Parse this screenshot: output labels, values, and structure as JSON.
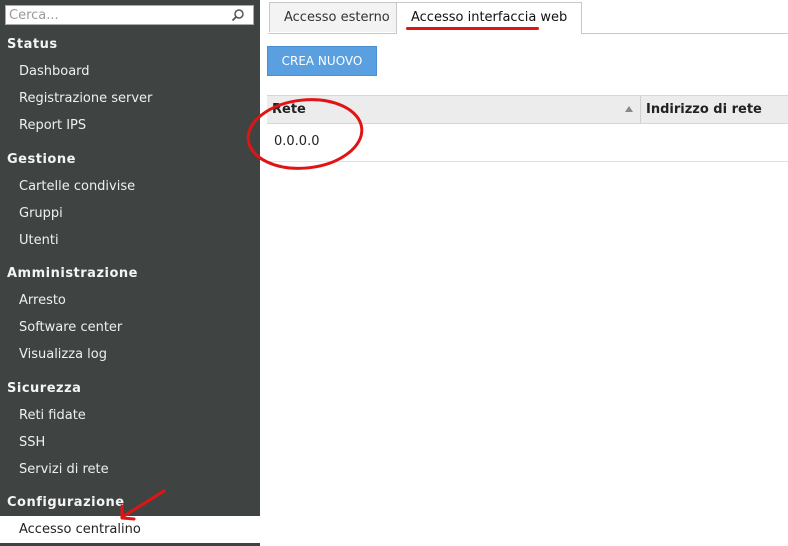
{
  "search": {
    "placeholder": "Cerca..."
  },
  "sidebar": {
    "sections": [
      {
        "title": "Status",
        "items": [
          "Dashboard",
          "Registrazione server",
          "Report IPS"
        ]
      },
      {
        "title": "Gestione",
        "items": [
          "Cartelle condivise",
          "Gruppi",
          "Utenti"
        ]
      },
      {
        "title": "Amministrazione",
        "items": [
          "Arresto",
          "Software center",
          "Visualizza log"
        ]
      },
      {
        "title": "Sicurezza",
        "items": [
          "Reti fidate",
          "SSH",
          "Servizi di rete"
        ]
      },
      {
        "title": "Configurazione",
        "items": [
          "Accesso centralino"
        ]
      }
    ],
    "active_item": "Accesso centralino"
  },
  "tabs": [
    {
      "label": "Accesso esterno",
      "active": false
    },
    {
      "label": "Accesso interfaccia web",
      "active": true
    }
  ],
  "toolbar": {
    "create_label": "CREA NUOVO"
  },
  "table": {
    "columns": [
      "Rete",
      "Indirizzo di rete"
    ],
    "rows": [
      [
        "0.0.0.0",
        ""
      ]
    ]
  },
  "colors": {
    "sidebar_bg": "#3f4443",
    "accent_button": "#5a9fe0",
    "annotation_red": "#e01414"
  },
  "icons": {
    "search": "search-icon",
    "sort": "sort-ascending-icon"
  }
}
